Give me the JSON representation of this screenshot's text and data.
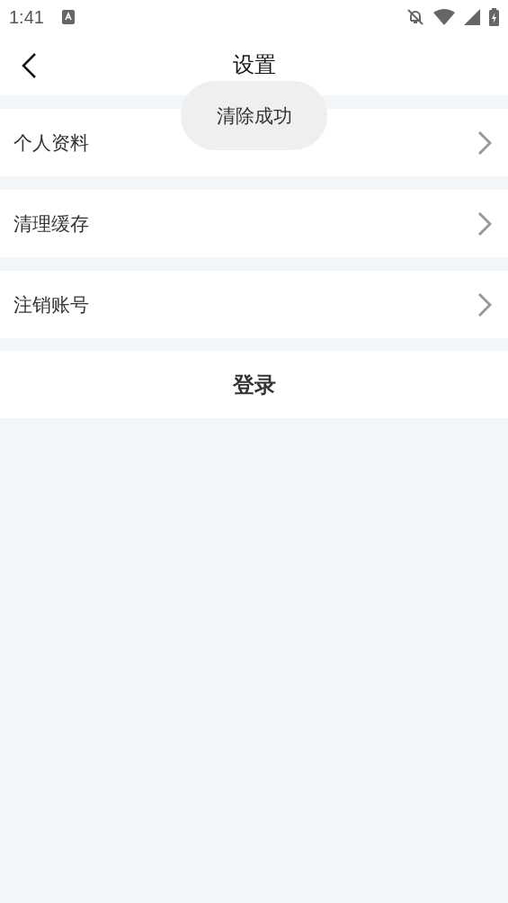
{
  "status_bar": {
    "time": "1:41"
  },
  "header": {
    "title": "设置"
  },
  "menu_items": [
    {
      "label": "个人资料"
    },
    {
      "label": "清理缓存"
    },
    {
      "label": "注销账号"
    }
  ],
  "login_button": {
    "label": "登录"
  },
  "toast": {
    "text": "清除成功"
  }
}
